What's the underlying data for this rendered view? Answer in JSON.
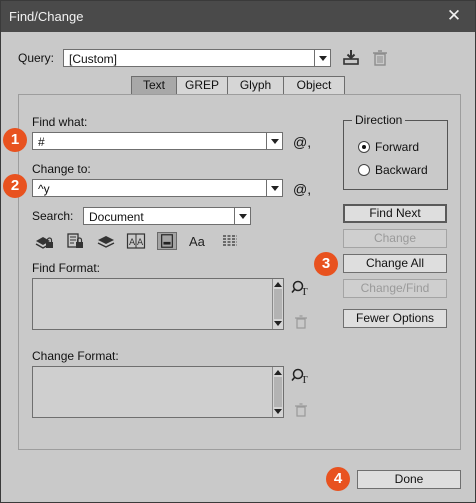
{
  "window": {
    "title": "Find/Change",
    "close": "✕"
  },
  "query": {
    "label": "Query:",
    "value": "[Custom]"
  },
  "tabs": [
    {
      "label": "Text",
      "active": true
    },
    {
      "label": "GREP",
      "active": false
    },
    {
      "label": "Glyph",
      "active": false
    },
    {
      "label": "Object",
      "active": false
    }
  ],
  "find_what": {
    "label": "Find what:",
    "value": "#",
    "special_char_icon": "@,"
  },
  "change_to": {
    "label": "Change to:",
    "value": "^y",
    "special_char_icon": "@,"
  },
  "search": {
    "label": "Search:",
    "value": "Document"
  },
  "find_format": {
    "label": "Find Format:"
  },
  "change_format": {
    "label": "Change Format:"
  },
  "direction": {
    "legend": "Direction",
    "options": [
      {
        "label": "Forward",
        "selected": true
      },
      {
        "label": "Backward",
        "selected": false
      }
    ]
  },
  "buttons": {
    "find_next": "Find Next",
    "change": "Change",
    "change_all": "Change All",
    "change_find": "Change/Find",
    "fewer_options": "Fewer Options",
    "done": "Done"
  },
  "badges": [
    "1",
    "2",
    "3",
    "4"
  ],
  "colors": {
    "badge": "#e8521f",
    "titlebar": "#4a4a4a",
    "dialog": "#c9c9c9"
  },
  "icons": [
    "save-query-icon",
    "delete-query-icon",
    "include-locked-layers-icon",
    "include-locked-stories-icon",
    "include-hidden-layers-icon",
    "include-master-pages-icon",
    "include-footnotes-icon",
    "case-sensitive-icon",
    "whole-word-icon",
    "specify-attributes-icon",
    "clear-attributes-icon"
  ]
}
